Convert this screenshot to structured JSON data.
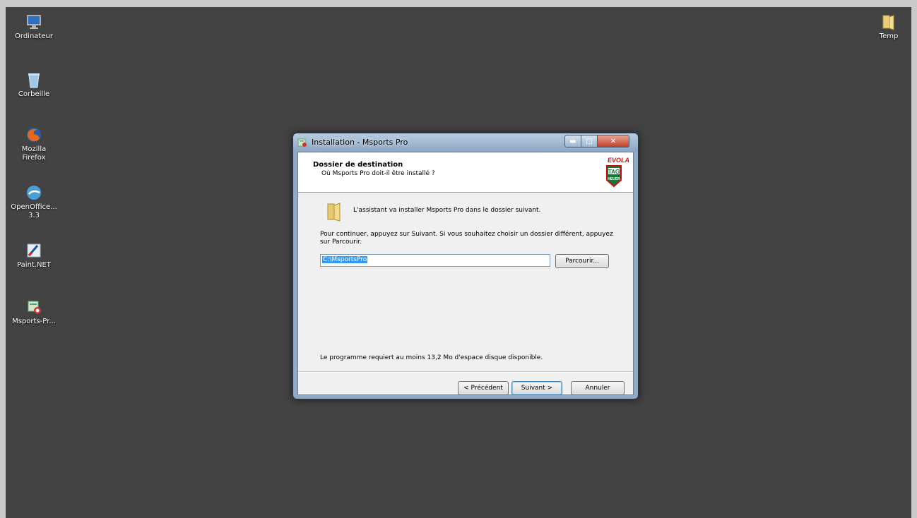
{
  "desktop": {
    "icons": [
      {
        "label": "Ordinateur",
        "icon": "computer-icon"
      },
      {
        "label": "Corbeille",
        "icon": "recycle-bin-icon"
      },
      {
        "label": "Mozilla Firefox",
        "icon": "firefox-icon"
      },
      {
        "label": "OpenOffice... 3.3",
        "icon": "openoffice-icon"
      },
      {
        "label": "Paint.NET",
        "icon": "paintnet-icon"
      },
      {
        "label": "Msports-Pr...",
        "icon": "msports-installer-icon"
      },
      {
        "label": "Temp",
        "icon": "folder-icon"
      }
    ]
  },
  "window": {
    "title": "Installation - Msports Pro",
    "header_title": "Dossier de destination",
    "header_subtitle": "Où Msports Pro doit-il être installé ?",
    "logo_top": "EVOLA",
    "logo_tag": "TAG",
    "logo_bottom": "HEUER",
    "intro": "L'assistant va installer Msports Pro dans le dossier suivant.",
    "instructions": "Pour continuer, appuyez sur Suivant. Si vous souhaitez choisir un dossier différent, appuyez sur Parcourir.",
    "path_value": "C:\\MsportsPro",
    "browse_label": "Parcourir...",
    "disk_space": "Le programme requiert au moins 13,2 Mo d'espace disque disponible.",
    "back_label": "< Précédent",
    "next_label": "Suivant >",
    "cancel_label": "Annuler"
  },
  "colors": {
    "desktop_bg": "#434343",
    "accent": "#3399ff",
    "close_button": "#c0402a"
  }
}
